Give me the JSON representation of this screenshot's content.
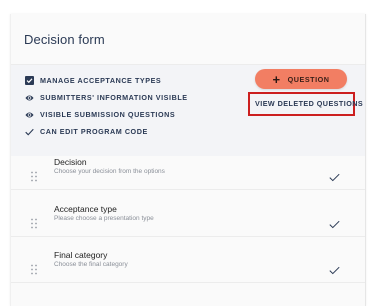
{
  "form": {
    "title": "Decision form"
  },
  "settings": [
    {
      "label": "MANAGE ACCEPTANCE TYPES",
      "icon": "checkbox-icon"
    },
    {
      "label": "SUBMITTERS' INFORMATION VISIBLE",
      "icon": "eye-icon"
    },
    {
      "label": "VISIBLE SUBMISSION QUESTIONS",
      "icon": "eye-icon"
    },
    {
      "label": "CAN EDIT PROGRAM CODE",
      "icon": "check-icon"
    }
  ],
  "actions": {
    "add_question_label": "QUESTION",
    "view_deleted_label": "VIEW DELETED QUESTIONS"
  },
  "questions": [
    {
      "title": "Decision",
      "subtitle": "Choose your decision from the options"
    },
    {
      "title": "Acceptance type",
      "subtitle": "Please choose a presentation type"
    },
    {
      "title": "Final category",
      "subtitle": "Choose the final category"
    }
  ],
  "colors": {
    "accent": "#f27e63",
    "text_primary": "#2b3a55",
    "highlight": "#cc1f1f"
  }
}
